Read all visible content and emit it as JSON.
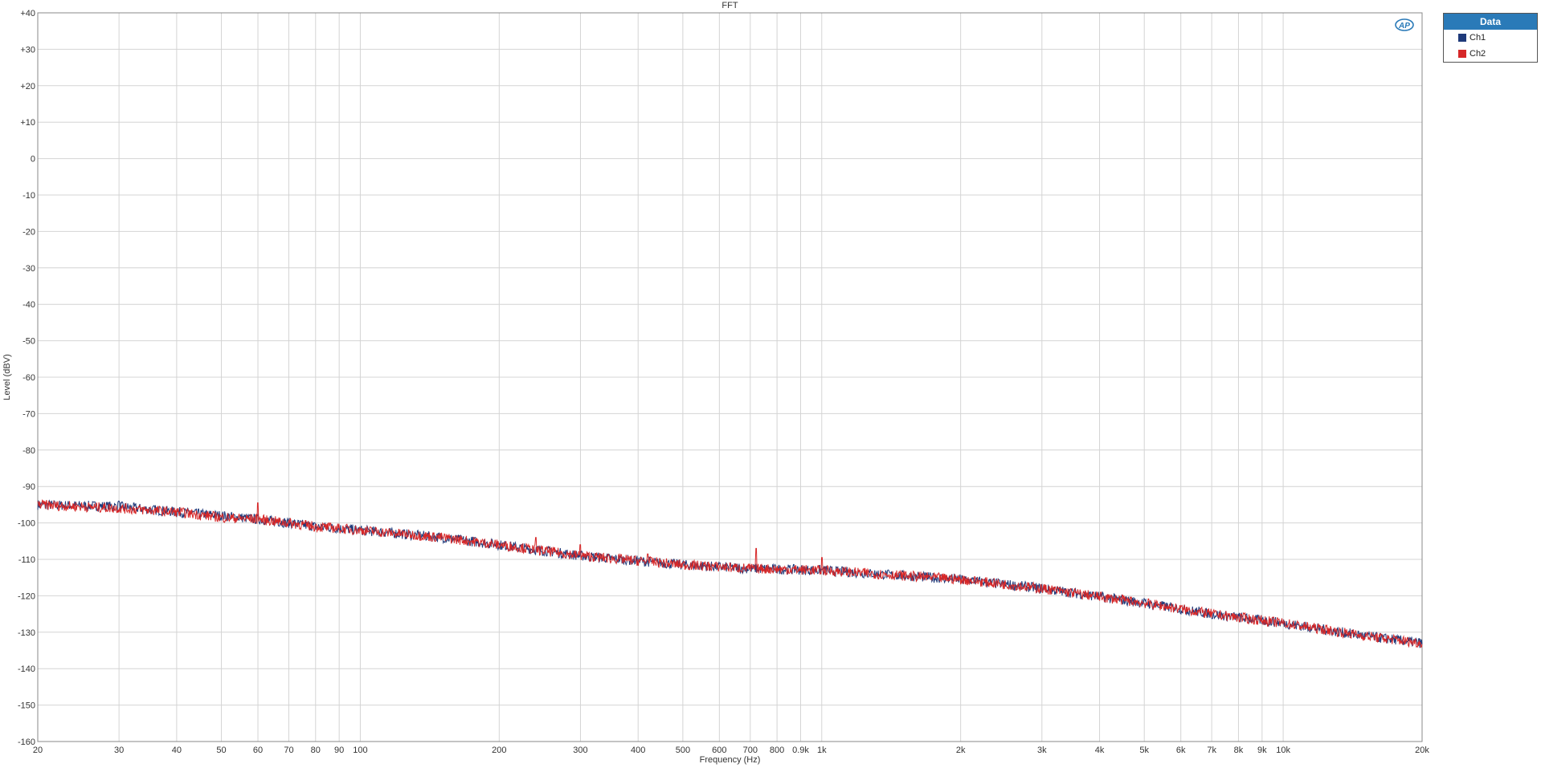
{
  "chart_data": {
    "type": "line",
    "title": "FFT",
    "xlabel": "Frequency (Hz)",
    "ylabel": "Level (dBV)",
    "xscale": "log",
    "xlim": [
      20,
      20000
    ],
    "ylim": [
      -160,
      40
    ],
    "grid": true,
    "legend_placement": "right",
    "legend_title": "Data",
    "x_tick_labels": [
      "20",
      "30",
      "40",
      "50",
      "60",
      "70",
      "80",
      "90",
      "100",
      "200",
      "300",
      "400",
      "500",
      "600",
      "700",
      "800",
      "0.9k",
      "1k",
      "2k",
      "3k",
      "4k",
      "5k",
      "6k",
      "7k",
      "8k",
      "9k",
      "10k",
      "20k"
    ],
    "y_tick_labels": [
      "+40",
      "+30",
      "+20",
      "+10",
      "0",
      "-10",
      "-20",
      "-30",
      "-40",
      "-50",
      "-60",
      "-70",
      "-80",
      "-90",
      "-100",
      "-110",
      "-120",
      "-130",
      "-140",
      "-150",
      "-160"
    ],
    "series": [
      {
        "name": "Ch1",
        "color": "#1f3a7a",
        "x": [
          20,
          30,
          40,
          50,
          60,
          70,
          80,
          100,
          150,
          200,
          300,
          500,
          700,
          1000,
          2000,
          3000,
          5000,
          7000,
          10000,
          15000,
          20000
        ],
        "y": [
          -95,
          -95.5,
          -97,
          -98,
          -99,
          -100,
          -101,
          -102,
          -104,
          -106,
          -109,
          -111.5,
          -112.5,
          -113,
          -115.5,
          -118,
          -122,
          -125,
          -127.5,
          -131,
          -133
        ],
        "noise": 1.4
      },
      {
        "name": "Ch2",
        "color": "#d62728",
        "x": [
          20,
          30,
          40,
          50,
          60,
          70,
          80,
          100,
          150,
          200,
          300,
          500,
          700,
          1000,
          2000,
          3000,
          5000,
          7000,
          10000,
          15000,
          20000
        ],
        "y": [
          -95,
          -96,
          -97,
          -98.5,
          -99,
          -100,
          -101,
          -102,
          -104,
          -106,
          -109,
          -111.5,
          -112.5,
          -113,
          -115.5,
          -118,
          -122,
          -125,
          -127.5,
          -131,
          -133
        ],
        "noise": 1.4
      }
    ],
    "spikes": [
      {
        "x": 60,
        "y": -94.5,
        "series": "Ch2"
      },
      {
        "x": 240,
        "y": -104,
        "series": "Ch2"
      },
      {
        "x": 300,
        "y": -106,
        "series": "Ch2"
      },
      {
        "x": 420,
        "y": -108.5,
        "series": "Ch2"
      },
      {
        "x": 720,
        "y": -107,
        "series": "Ch2"
      },
      {
        "x": 1000,
        "y": -109.5,
        "series": "Ch2"
      },
      {
        "x": 30,
        "y": -94,
        "series": "Ch1"
      }
    ]
  }
}
